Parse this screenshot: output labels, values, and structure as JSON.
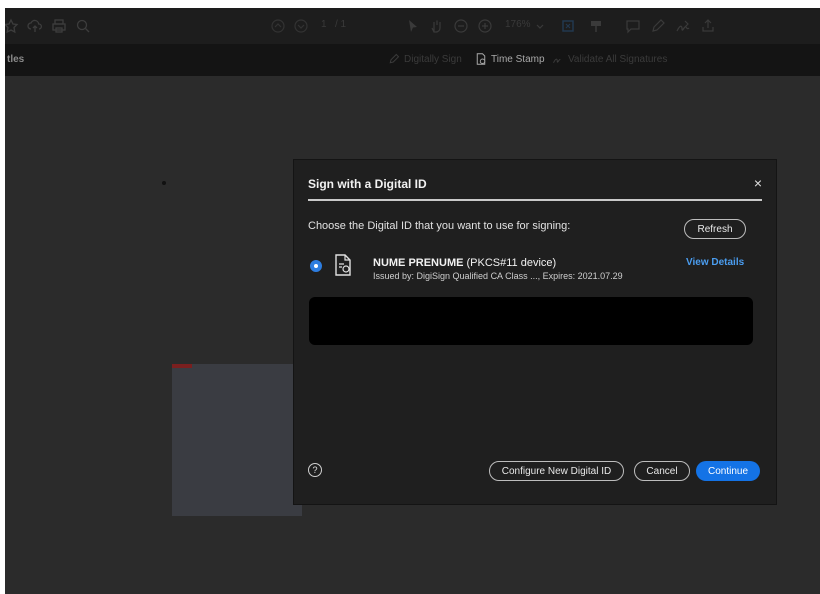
{
  "toolbar": {
    "page_current": "1",
    "page_total": "/ 1",
    "zoom": "176%"
  },
  "subbar": {
    "left_label": "tles",
    "digitally_sign": "Digitally Sign",
    "time_stamp": "Time Stamp",
    "validate_all": "Validate All Signatures"
  },
  "dialog": {
    "title": "Sign with a Digital ID",
    "close": "×",
    "choose_text": "Choose the Digital ID that you want to use for signing:",
    "refresh": "Refresh",
    "id_name": "NUME PRENUME",
    "id_type": "(PKCS#11 device)",
    "id_issued": "Issued by: DigiSign Qualified CA Class ..., Expires: 2021.07.29",
    "view_details": "View Details",
    "help": "?",
    "configure": "Configure New Digital ID",
    "cancel": "Cancel",
    "continue": "Continue"
  },
  "colors": {
    "accent": "#1473e6",
    "link": "#4a9df0",
    "dialog_bg": "#1f1f1f",
    "app_bg": "#2b2b2b"
  }
}
